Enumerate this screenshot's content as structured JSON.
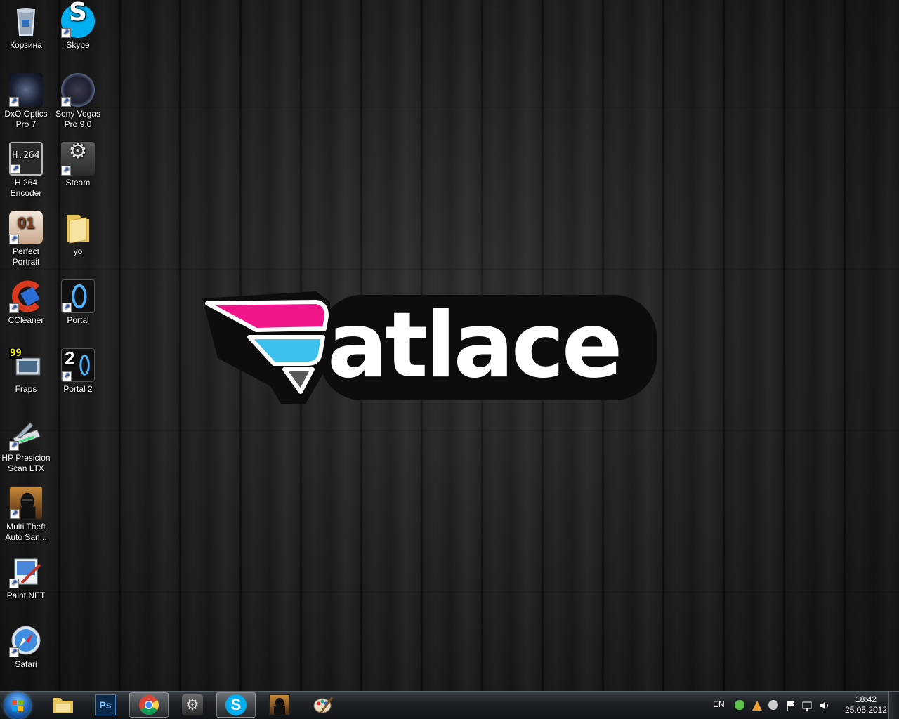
{
  "desktop": {
    "icons": [
      {
        "label": "Корзина"
      },
      {
        "label": "Skype"
      },
      {
        "label": "DxO Optics Pro 7"
      },
      {
        "label": "Sony Vegas Pro 9.0"
      },
      {
        "label": "H.264 Encoder"
      },
      {
        "label": "Steam"
      },
      {
        "label": "Perfect Portrait"
      },
      {
        "label": "yo"
      },
      {
        "label": "CCleaner"
      },
      {
        "label": "Portal"
      },
      {
        "label": "Fraps"
      },
      {
        "label": "Portal 2"
      },
      {
        "label": "HP Presicion Scan LTX"
      },
      {
        "label": "Multi Theft Auto San..."
      },
      {
        "label": "Paint.NET"
      },
      {
        "label": "Safari"
      }
    ],
    "icon_glyphs": {
      "h264": "H.264",
      "perfect_portrait": "01",
      "fraps": "99",
      "portal2": "2",
      "steam": "⚙",
      "skype": "S"
    }
  },
  "wallpaper": {
    "logo_text": "atlace",
    "colors": {
      "pink": "#f0168a",
      "blue": "#3cc1ef",
      "white": "#ffffff",
      "outline": "#0d0d0d"
    }
  },
  "taskbar": {
    "pinned": [
      {
        "name": "Windows Explorer"
      },
      {
        "name": "Adobe Photoshop",
        "glyph": "Ps"
      },
      {
        "name": "Google Chrome",
        "active": true
      },
      {
        "name": "Steam"
      },
      {
        "name": "Skype",
        "active": true,
        "glyph": "S"
      },
      {
        "name": "Multi Theft Auto"
      },
      {
        "name": "Paint.NET"
      }
    ],
    "tray": {
      "language": "EN",
      "time": "18:42",
      "date": "25.05.2012"
    }
  }
}
